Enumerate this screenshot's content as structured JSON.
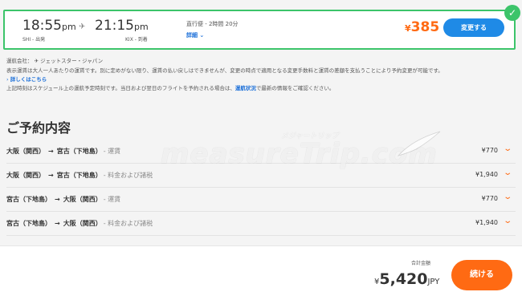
{
  "flight": {
    "departure_time": "18:55",
    "departure_ampm": "pm",
    "departure_sub": "SHI - 出発",
    "arrival_time": "21:15",
    "arrival_ampm": "pm",
    "arrival_sub": "KIX - 到着",
    "flight_type": "直行便 - 2時間 20分",
    "details_label": "詳細 ⌄",
    "price_currency": "¥",
    "price_value": "385",
    "change_button": "変更する",
    "accent_color": "#3cc46a"
  },
  "info": {
    "carrier_label": "運航会社：",
    "carrier_name": "ジェットスター・ジャパン",
    "fare_note": "表示運賃は大人一人あたりの運賃です。別に定めがない限り、運賃の払い戻しはできませんが、変更の時点で適用となる変更手数料と運賃の差額を支払うことにより予約変更が可能です。",
    "details_link": "詳しくはこちら",
    "schedule_note_pre": "上記時刻はスケジュール上の運航予定時刻です。当日および翌日のフライトを予約される場合は、",
    "schedule_link": "運航状況",
    "schedule_note_post": "で最新の情報をご確認ください。"
  },
  "booking": {
    "title": "ご予約内容",
    "rows": [
      {
        "from": "大阪（関西）",
        "to": "宮古（下地島）",
        "type": "- 運賃",
        "amount": "¥770"
      },
      {
        "from": "大阪（関西）",
        "to": "宮古（下地島）",
        "type": "- 料金および諸税",
        "amount": "¥1,940"
      },
      {
        "from": "宮古（下地島）",
        "to": "大阪（関西）",
        "type": "- 運賃",
        "amount": "¥770"
      },
      {
        "from": "宮古（下地島）",
        "to": "大阪（関西）",
        "type": "- 料金および諸税",
        "amount": "¥1,940"
      }
    ],
    "arrow": "→"
  },
  "footer": {
    "total_label": "合計金額",
    "total_currency_symbol": "¥",
    "total_value": "5,420",
    "total_currency_code": "JPY",
    "continue_button": "続ける",
    "accent_color": "#ff6a13"
  },
  "watermark": {
    "text": "measureTrip.com",
    "kana": "メジャートリップ"
  }
}
